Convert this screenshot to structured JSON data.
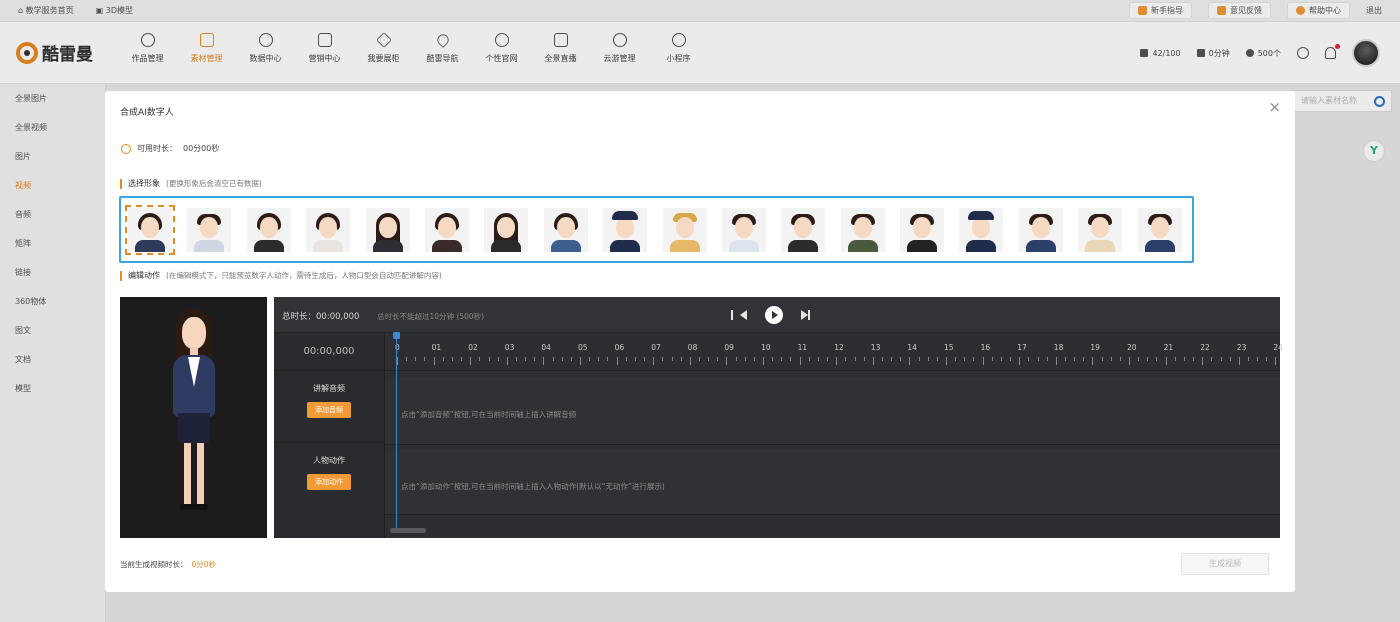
{
  "topbar": {
    "left": [
      "教学服务首页",
      "3D模型"
    ],
    "right": [
      "新手指导",
      "意见反馈",
      "帮助中心",
      "退出"
    ]
  },
  "logo": {
    "text": "酷雷曼"
  },
  "nav": [
    {
      "label": "作品管理",
      "icon": "grid-icon"
    },
    {
      "label": "素材管理",
      "icon": "folder-icon"
    },
    {
      "label": "数据中心",
      "icon": "chart-icon"
    },
    {
      "label": "营销中心",
      "icon": "gift-icon"
    },
    {
      "label": "我要展柜",
      "icon": "cube-icon"
    },
    {
      "label": "酷雷导航",
      "icon": "location-icon"
    },
    {
      "label": "个性官网",
      "icon": "globe-icon"
    },
    {
      "label": "全景直播",
      "icon": "live-icon"
    },
    {
      "label": "云游管理",
      "icon": "planet-icon"
    },
    {
      "label": "小程序",
      "icon": "compass-icon"
    }
  ],
  "header_right": {
    "stat1": "42/100",
    "stat2": "0分钟",
    "stat3": "500个"
  },
  "sidebar": [
    "全景图片",
    "全景视频",
    "图片",
    "视频",
    "音频",
    "矩阵",
    "链接",
    "360物体",
    "图文",
    "文档",
    "模型"
  ],
  "bg_search_placeholder": "请输入素材名称",
  "bg_badge": "Y",
  "modal": {
    "title": "合成AI数字人",
    "close": "×",
    "usage_label": "可用时长：",
    "usage_value": "00分00秒",
    "section1_title": "选择形象",
    "section1_note": "(更换形象后会清空已有数据)",
    "section2_title": "编辑动作",
    "section2_note": "(在编辑模式下，只能预览数字人动作，需待生成后，人物口型会自动匹配讲解内容)",
    "avatars": [
      {
        "name": "female-1",
        "kind": "f",
        "body": "#2d3a5a"
      },
      {
        "name": "male-1",
        "kind": "m",
        "body": "#cfd7e2"
      },
      {
        "name": "female-2",
        "kind": "f",
        "body": "#2b2b2b"
      },
      {
        "name": "female-3",
        "kind": "f",
        "body": "#e9e4e0"
      },
      {
        "name": "female-4",
        "kind": "fl",
        "body": "#2d2d35"
      },
      {
        "name": "female-5",
        "kind": "f",
        "body": "#3a2a2a"
      },
      {
        "name": "female-6",
        "kind": "fl",
        "body": "#2a2a2a"
      },
      {
        "name": "female-7",
        "kind": "f",
        "body": "#3d5f8e"
      },
      {
        "name": "police-female",
        "kind": "c",
        "body": "#1f2c4a"
      },
      {
        "name": "female-8",
        "kind": "h",
        "body": "#e8b86a"
      },
      {
        "name": "male-2",
        "kind": "m",
        "body": "#dfe5ee"
      },
      {
        "name": "male-3",
        "kind": "m",
        "body": "#2b2b2b"
      },
      {
        "name": "male-4",
        "kind": "m",
        "body": "#4a5a3c"
      },
      {
        "name": "male-5",
        "kind": "m",
        "body": "#222"
      },
      {
        "name": "police-male",
        "kind": "c",
        "body": "#1f2c4a"
      },
      {
        "name": "male-6",
        "kind": "m",
        "body": "#2a3f6a"
      },
      {
        "name": "male-7",
        "kind": "m",
        "body": "#e9d7b8"
      },
      {
        "name": "male-8",
        "kind": "m",
        "body": "#2a3f6a"
      }
    ],
    "editor": {
      "total_label": "总时长：",
      "total_value": "00:00,000",
      "limit_note": "总时长不能超过10分钟 (500秒)",
      "time_display": "00:00,000",
      "ruler": [
        "0",
        "01",
        "02",
        "03",
        "04",
        "05",
        "06",
        "07",
        "08",
        "09",
        "10",
        "11",
        "12",
        "13",
        "14",
        "15",
        "16",
        "17",
        "18",
        "19",
        "20",
        "21",
        "22",
        "23",
        "24"
      ],
      "track1_label": "讲解音频",
      "track1_button": "添加音频",
      "track1_hint": "点击“添加音频”按钮,可在当前时间轴上插入讲解音频",
      "track2_label": "人物动作",
      "track2_button": "添加动作",
      "track2_hint": "点击“添加动作”按钮,可在当前时间轴上插入人物动作(默认以“无动作”进行展示)"
    },
    "footer_label": "当前生成视频时长：",
    "footer_value": "0分0秒",
    "generate_button": "生成视频"
  }
}
